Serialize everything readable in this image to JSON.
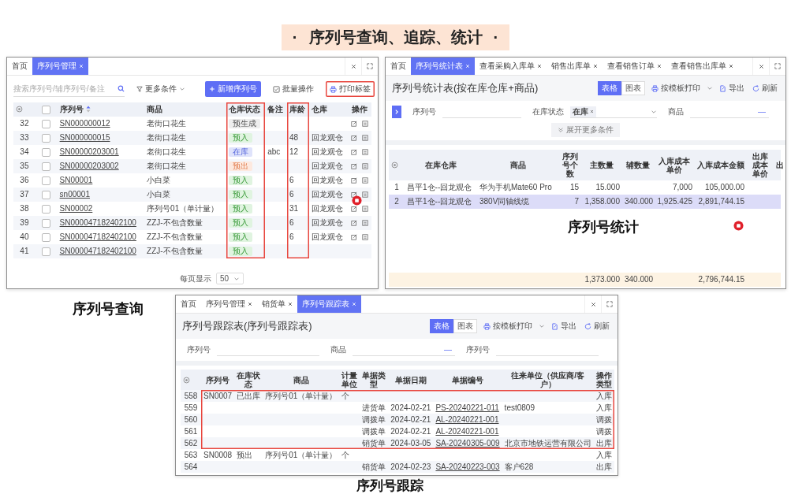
{
  "heading": {
    "prefix": "·",
    "title": "序列号查询、追踪、统计",
    "suffix": "·"
  },
  "windows": [
    {
      "kind": "query",
      "caption": "序列号查询",
      "tabs": [
        {
          "label": "首页",
          "closable": false,
          "selected": false
        },
        {
          "label": "序列号管理",
          "closable": true,
          "selected": true
        }
      ],
      "search": {
        "placeholder": "搜索序列号/辅序列号/备注"
      },
      "filter": "更多条件",
      "actions": [
        {
          "label": "新增序列号",
          "kind": "primary",
          "highlighted": false
        },
        {
          "label": "批量操作",
          "kind": "batch",
          "highlighted": false
        },
        {
          "label": "打印标签",
          "kind": "print",
          "highlighted": true
        }
      ],
      "select_all": false,
      "columns": [
        {
          "label": "序列号",
          "sortable": true,
          "highlighted": false
        },
        {
          "label": "商品",
          "sortable": false,
          "highlighted": false
        },
        {
          "label": "仓库状态",
          "sortable": false,
          "highlighted": true
        },
        {
          "label": "备注",
          "sortable": false,
          "highlighted": false
        },
        {
          "label": "库龄",
          "sortable": false,
          "highlighted": true
        },
        {
          "label": "仓库",
          "sortable": false,
          "highlighted": false
        },
        {
          "label": "操作",
          "sortable": false,
          "highlighted": false
        }
      ],
      "rows": [
        {
          "no": "32",
          "checked": false,
          "serial": "SN000000012",
          "product": "老街口花生",
          "status": {
            "label": "预生成",
            "kind": "pending"
          },
          "actions_shown": true
        },
        {
          "no": "33",
          "checked": false,
          "serial": "SN000000015",
          "product": "老街口花生",
          "status": {
            "label": "预入",
            "kind": "in"
          },
          "age": "48",
          "warehouse": "回龙观仓",
          "actions_shown": true
        },
        {
          "no": "34",
          "checked": false,
          "serial": "SN00000203001",
          "product": "老街口花生",
          "status": {
            "label": "在库",
            "kind": "stock"
          },
          "note": "abc",
          "age": "12",
          "warehouse": "回龙观仓",
          "actions_shown": true
        },
        {
          "no": "35",
          "checked": false,
          "serial": "SN00000203002",
          "product": "老街口花生",
          "status": {
            "label": "预出",
            "kind": "out"
          },
          "warehouse": "回龙观仓",
          "actions_shown": true
        },
        {
          "no": "36",
          "checked": false,
          "serial": "SN00001",
          "product": "小白菜",
          "status": {
            "label": "预入",
            "kind": "in"
          },
          "age": "6",
          "warehouse": "回龙观仓",
          "actions_shown": true
        },
        {
          "no": "37",
          "checked": false,
          "serial": "sn00001",
          "product": "小白菜",
          "status": {
            "label": "预入",
            "kind": "in"
          },
          "age": "6",
          "warehouse": "回龙观仓",
          "actions_shown": true
        },
        {
          "no": "38",
          "checked": false,
          "serial": "SN00002",
          "product": "序列号01（单计量）",
          "status": {
            "label": "预入",
            "kind": "in"
          },
          "age": "31",
          "warehouse": "回龙观仓",
          "actions_shown": true
        },
        {
          "no": "39",
          "checked": false,
          "serial": "SN000047182402100",
          "product": "ZZJ-不包含数量",
          "status": {
            "label": "预入",
            "kind": "in"
          },
          "age": "6",
          "warehouse": "回龙观仓",
          "actions_shown": true
        },
        {
          "no": "40",
          "checked": false,
          "serial": "SN000047182402100",
          "product": "ZZJ-不包含数量",
          "status": {
            "label": "预入",
            "kind": "in"
          },
          "age": "6",
          "warehouse": "回龙观仓",
          "actions_shown": true
        },
        {
          "no": "41",
          "checked": false,
          "serial": "SN000047182402100",
          "product": "ZZJ-不包含数量",
          "status": {
            "label": "预入",
            "kind": "in"
          },
          "actions_shown": false
        }
      ],
      "pager": {
        "label": "每页显示",
        "size": "50"
      }
    },
    {
      "kind": "stats",
      "caption": "序列号统计",
      "tabs": [
        {
          "label": "首页",
          "closable": false,
          "selected": false
        },
        {
          "label": "序列号统计表",
          "closable": true,
          "selected": true
        },
        {
          "label": "查看采购入库单",
          "closable": true,
          "selected": false
        },
        {
          "label": "销售出库单",
          "closable": true,
          "selected": false
        },
        {
          "label": "查看销售订单",
          "closable": true,
          "selected": false
        },
        {
          "label": "查看销售出库单",
          "closable": true,
          "selected": false
        }
      ],
      "title": "序列号统计表(按在库仓库+商品)",
      "views": [
        {
          "label": "表格",
          "selected": true
        },
        {
          "label": "图表",
          "selected": false
        }
      ],
      "tools": [
        {
          "label": "按模板打印",
          "kind": "print"
        },
        {
          "label": "导出",
          "kind": "export"
        },
        {
          "label": "刷新",
          "kind": "refresh"
        }
      ],
      "filters": [
        {
          "label": "序列号",
          "kind": "text"
        },
        {
          "label": "在库状态",
          "kind": "select",
          "tags": [
            "在库"
          ]
        },
        {
          "label": "商品",
          "kind": "range",
          "separator": "—"
        }
      ],
      "more": "展开更多条件",
      "columns": [
        "在库仓库",
        "商品",
        "序列号个数",
        "主数量",
        "辅数量",
        "入库成本单价",
        "入库成本金额",
        "出库成本单价",
        "出"
      ],
      "rows": [
        {
          "no": "1",
          "selected": false,
          "cells": [
            "昌平1仓--回龙观仓",
            "华为手机Mate60 Pro",
            "15",
            "15.000",
            null,
            "7,000",
            "105,000.00",
            null,
            null
          ]
        },
        {
          "no": "2",
          "selected": true,
          "cells": [
            "昌平1仓--回龙观仓",
            "380V同轴线缆",
            "7",
            "1,358.000",
            "340.000",
            "1,925.425",
            "2,891,744.15",
            null,
            null
          ]
        }
      ],
      "summary": {
        "main_qty": "1,373.000",
        "aux_qty": "340.000",
        "in_amount": "2,796,744.15"
      }
    },
    {
      "kind": "track",
      "caption": "序列号跟踪",
      "tabs": [
        {
          "label": "首页",
          "closable": false,
          "selected": false
        },
        {
          "label": "序列号管理",
          "closable": true,
          "selected": false
        },
        {
          "label": "销货单",
          "closable": true,
          "selected": false
        },
        {
          "label": "序列号跟踪表",
          "closable": true,
          "selected": true
        }
      ],
      "title": "序列号跟踪表(序列号跟踪表)",
      "views": [
        {
          "label": "表格",
          "selected": true
        },
        {
          "label": "图表",
          "selected": false
        }
      ],
      "tools": [
        {
          "label": "按模板打印",
          "kind": "print"
        },
        {
          "label": "导出",
          "kind": "export"
        },
        {
          "label": "刷新",
          "kind": "refresh"
        }
      ],
      "filters": [
        {
          "label": "序列号",
          "kind": "text"
        },
        {
          "label": "商品",
          "kind": "range",
          "separator": "—"
        },
        {
          "label": "序列号",
          "kind": "text"
        }
      ],
      "columns": [
        "序列号",
        "在库状态",
        "商品",
        "计量单位",
        "单据类型",
        "单据日期",
        "单据编号",
        "往来单位（供应商/客户）",
        "操作类型"
      ],
      "rows": [
        {
          "no": "558",
          "boxed": true,
          "cells": [
            "SN0007",
            "已出库",
            "序列号01（单计量）",
            "个",
            null,
            null,
            null,
            null,
            "入库"
          ]
        },
        {
          "no": "559",
          "boxed": true,
          "cells": [
            null,
            null,
            null,
            null,
            "进货单",
            "2024-02-21",
            "PS-20240221-011",
            "test0809",
            "入库"
          ]
        },
        {
          "no": "560",
          "boxed": true,
          "cells": [
            null,
            null,
            null,
            null,
            "调拨单",
            "2024-02-21",
            "AL-20240221-001",
            null,
            "调拨"
          ]
        },
        {
          "no": "561",
          "boxed": true,
          "cells": [
            null,
            null,
            null,
            null,
            "调拨单",
            "2024-02-21",
            "AL-20240221-001",
            null,
            "调拨"
          ]
        },
        {
          "no": "562",
          "boxed": true,
          "cells": [
            null,
            null,
            null,
            null,
            "销货单",
            "2024-03-05",
            "SA-20240305-009",
            "北京市地铁运营有限公司",
            "出库"
          ]
        },
        {
          "no": "563",
          "boxed": false,
          "cells": [
            "SN0008",
            "预出",
            "序列号01（单计量）",
            "个",
            null,
            null,
            null,
            null,
            "入库"
          ]
        },
        {
          "no": "564",
          "boxed": false,
          "cells": [
            null,
            null,
            null,
            null,
            "销货单",
            "2024-02-23",
            "SA-20240223-003",
            "客户628",
            "出库"
          ]
        }
      ]
    }
  ]
}
